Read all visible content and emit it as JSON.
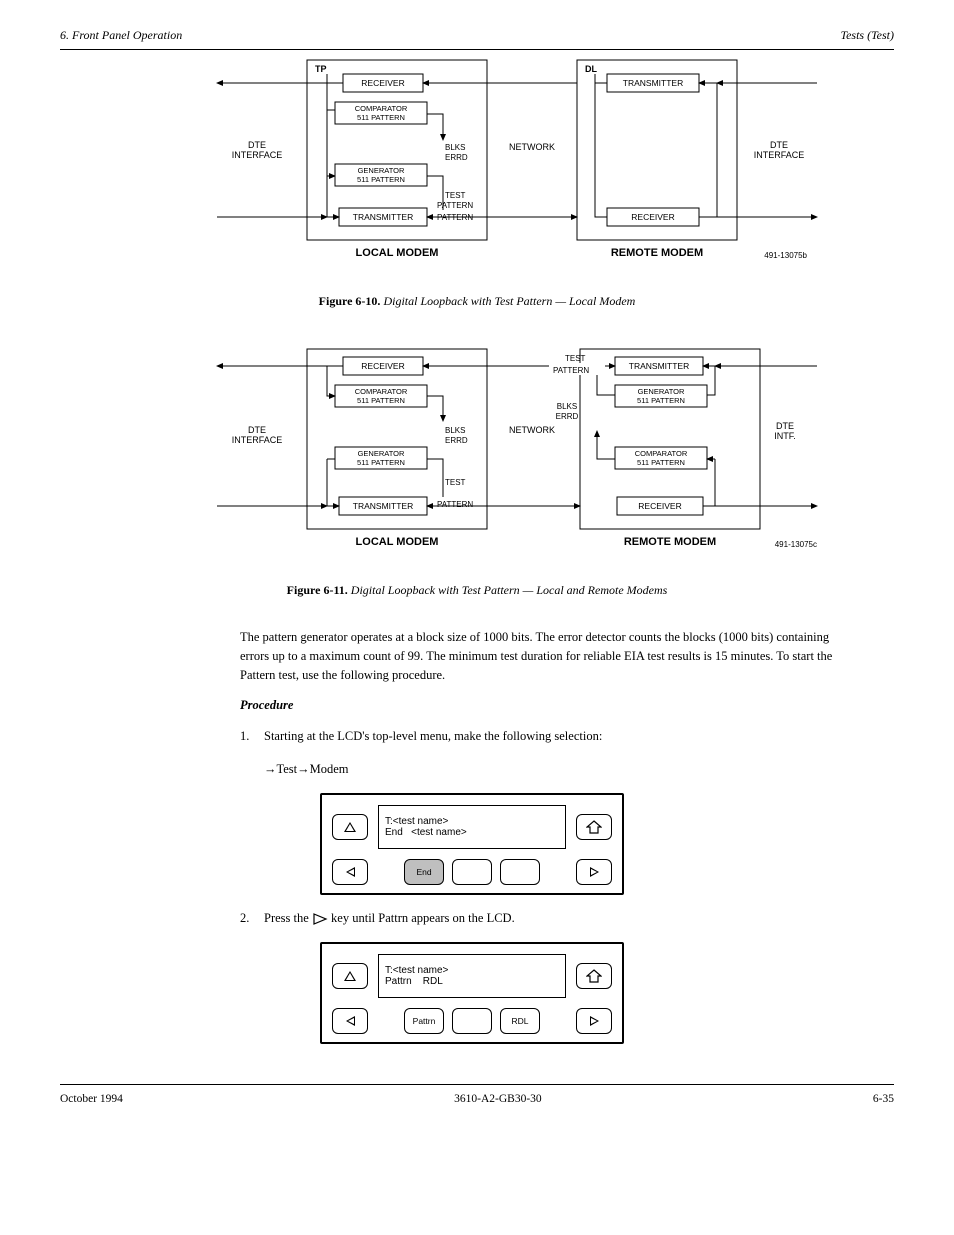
{
  "header": {
    "left": "6. Front Panel Operation",
    "right": "Tests (Test)"
  },
  "footer": {
    "left": "October 1994",
    "center": "3610-A2-GB30-30",
    "right": "6-35"
  },
  "fig1": {
    "prefix": "Figure 6-10.",
    "title": "Digital Loopback with Test Pattern — Local Modem",
    "leftIface": "DTE\nINTERFACE",
    "rightIface": "DTE\nINTERFACE",
    "network": "NETWORK",
    "local": {
      "tag": "TP",
      "boxes": {
        "recv": "RECEIVER",
        "comp": "COMPARATOR\n511 PATTERN",
        "gen": "GENERATOR\n511 PATTERN",
        "trans": "TRANSMITTER"
      },
      "blks": "BLKS\nERRD",
      "test": "TEST\nPATTERN",
      "label": "LOCAL MODEM"
    },
    "remote": {
      "tag": "DL",
      "boxes": {
        "trans": "TRANSMITTER",
        "recv": "RECEIVER"
      },
      "label": "REMOTE MODEM"
    },
    "code": "491-13075b"
  },
  "fig2": {
    "prefix": "Figure 6-11.",
    "title": "Digital Loopback with Test Pattern — Local and Remote Modems",
    "leftIface": "DTE\nINTERFACE",
    "rightIface": "DTE\nINTF.",
    "network": "NETWORK",
    "blks": "BLKS\nERRD",
    "local": {
      "boxes": {
        "recv": "RECEIVER",
        "comp": "COMPARATOR\n511 PATTERN",
        "gen": "GENERATOR\n511 PATTERN",
        "trans": "TRANSMITTER"
      },
      "blks": "BLKS\nERRD",
      "test": "TEST\nPATTERN",
      "label": "LOCAL MODEM"
    },
    "remote": {
      "boxes": {
        "trans": "TRANSMITTER",
        "gen": "GENERATOR\n511 PATTERN",
        "comp": "COMPARATOR\n511 PATTERN",
        "recv": "RECEIVER"
      },
      "test": "TEST\nPATTERN",
      "label": "REMOTE MODEM"
    },
    "code": "491-13075c"
  },
  "para1": "The pattern generator operates at a block size of 1000 bits. The error detector counts the blocks (1000 bits) containing errors up to a maximum count of 99. The minimum test duration for reliable EIA test results is 15 minutes. To start the Pattern test, use the following procedure.",
  "sub1": "Procedure",
  "step1": {
    "n": "1.",
    "t": "Starting at the LCD's top-level menu, make the following selection:"
  },
  "step1note": "→Test→Modem",
  "lcd1": {
    "line1": "T:<test name>",
    "line2": "End   <test name>",
    "softkeys": [
      "End",
      "",
      ""
    ]
  },
  "step2a": "2.",
  "step2t": "Press the    key until Pattrn appears on the LCD.",
  "lcd2": {
    "line1": "T:<test name>",
    "line2": "Pattrn    RDL",
    "softkeys": [
      "Pattrn",
      "",
      "RDL"
    ]
  },
  "icons": {
    "up": "up-triangle-icon",
    "home": "home-icon",
    "left": "left-triangle-icon",
    "right": "right-triangle-icon"
  }
}
